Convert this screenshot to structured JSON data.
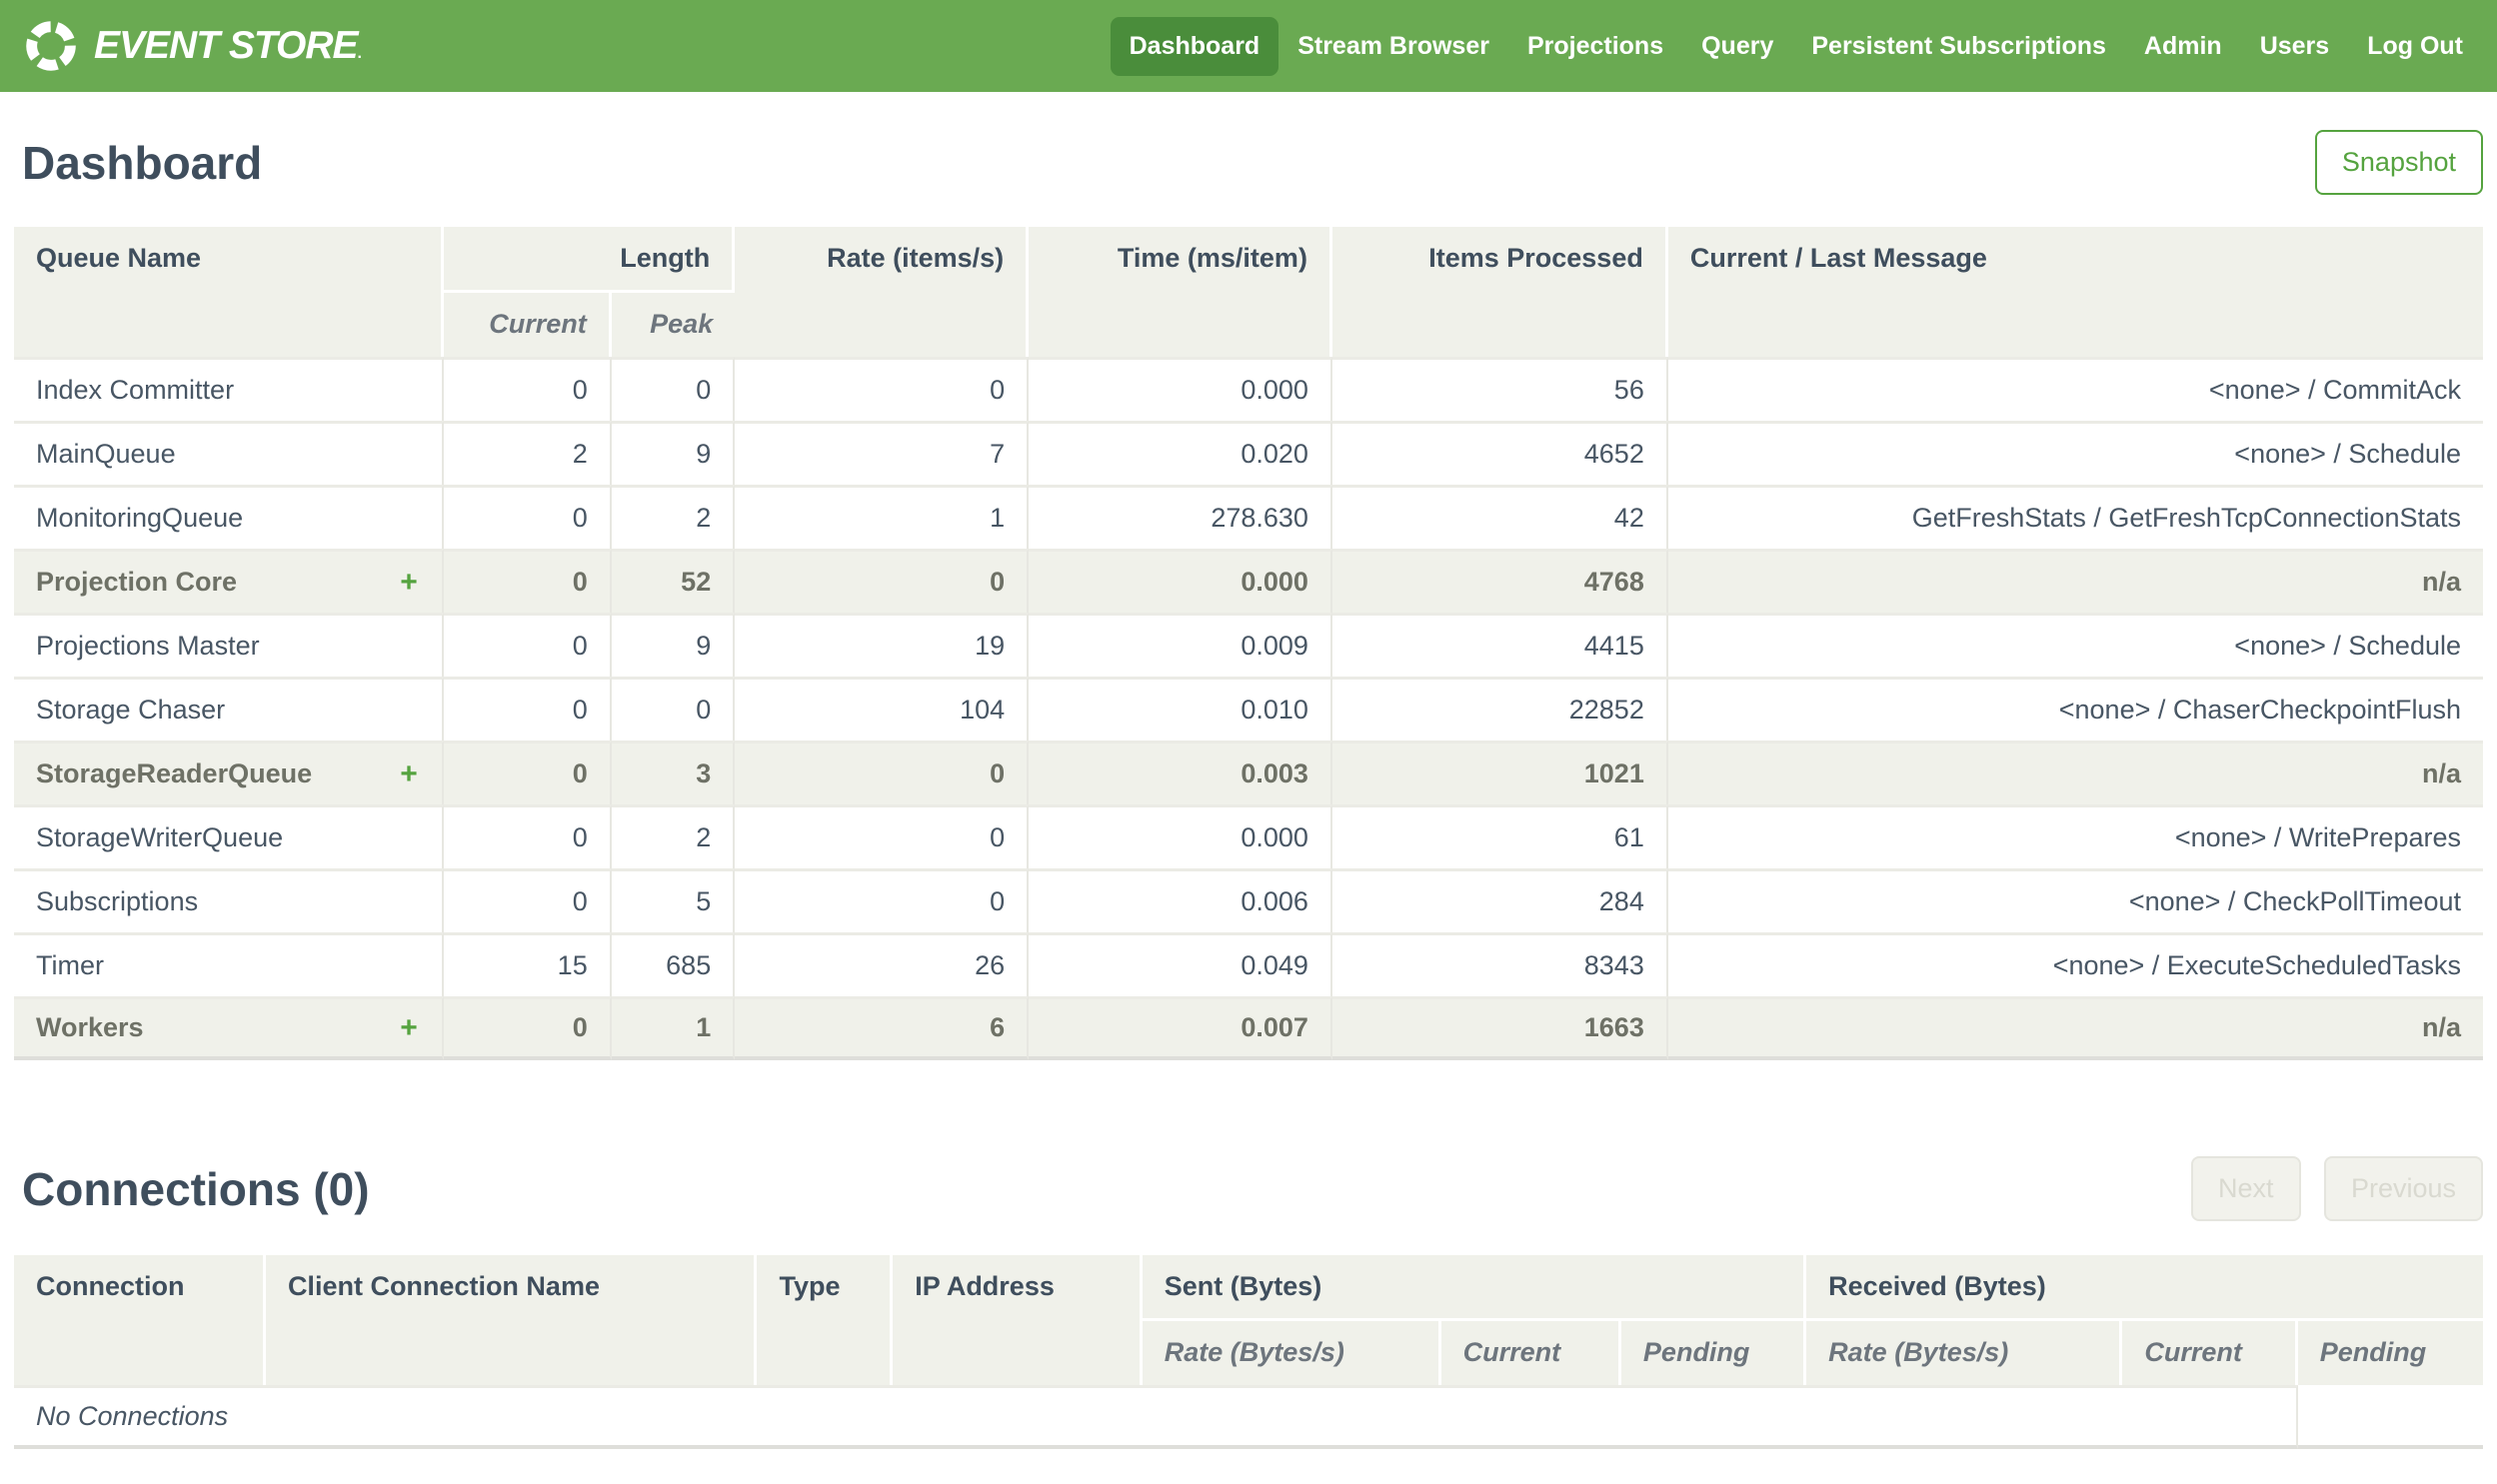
{
  "colors": {
    "nav_green": "#6aaa52",
    "nav_green_active": "#4a8d3b",
    "accent_green": "#55a33f",
    "heading_slate": "#3f4e5d",
    "header_bg": "#f0f1ea"
  },
  "nav": {
    "brand": "EVENT STORE",
    "brand_suffix": ".",
    "items": [
      {
        "label": "Dashboard",
        "active": true
      },
      {
        "label": "Stream Browser",
        "active": false
      },
      {
        "label": "Projections",
        "active": false
      },
      {
        "label": "Query",
        "active": false
      },
      {
        "label": "Persistent Subscriptions",
        "active": false
      },
      {
        "label": "Admin",
        "active": false
      },
      {
        "label": "Users",
        "active": false
      },
      {
        "label": "Log Out",
        "active": false
      }
    ]
  },
  "page": {
    "title": "Dashboard",
    "snapshot_label": "Snapshot"
  },
  "queues": {
    "expand_icon": "+",
    "headers": {
      "queue_name": "Queue Name",
      "length": "Length",
      "current": "Current",
      "peak": "Peak",
      "rate": "Rate (items/s)",
      "time": "Time (ms/item)",
      "items_processed": "Items Processed",
      "message": "Current / Last Message"
    },
    "rows": [
      {
        "name": "Index Committer",
        "group": false,
        "expandable": false,
        "current": "0",
        "peak": "0",
        "rate": "0",
        "time": "0.000",
        "items": "56",
        "message": "<none> / CommitAck"
      },
      {
        "name": "MainQueue",
        "group": false,
        "expandable": false,
        "current": "2",
        "peak": "9",
        "rate": "7",
        "time": "0.020",
        "items": "4652",
        "message": "<none> / Schedule"
      },
      {
        "name": "MonitoringQueue",
        "group": false,
        "expandable": false,
        "current": "0",
        "peak": "2",
        "rate": "1",
        "time": "278.630",
        "items": "42",
        "message": "GetFreshStats / GetFreshTcpConnectionStats"
      },
      {
        "name": "Projection Core",
        "group": true,
        "expandable": true,
        "current": "0",
        "peak": "52",
        "rate": "0",
        "time": "0.000",
        "items": "4768",
        "message": "n/a"
      },
      {
        "name": "Projections Master",
        "group": false,
        "expandable": false,
        "current": "0",
        "peak": "9",
        "rate": "19",
        "time": "0.009",
        "items": "4415",
        "message": "<none> / Schedule"
      },
      {
        "name": "Storage Chaser",
        "group": false,
        "expandable": false,
        "current": "0",
        "peak": "0",
        "rate": "104",
        "time": "0.010",
        "items": "22852",
        "message": "<none> / ChaserCheckpointFlush"
      },
      {
        "name": "StorageReaderQueue",
        "group": true,
        "expandable": true,
        "current": "0",
        "peak": "3",
        "rate": "0",
        "time": "0.003",
        "items": "1021",
        "message": "n/a"
      },
      {
        "name": "StorageWriterQueue",
        "group": false,
        "expandable": false,
        "current": "0",
        "peak": "2",
        "rate": "0",
        "time": "0.000",
        "items": "61",
        "message": "<none> / WritePrepares"
      },
      {
        "name": "Subscriptions",
        "group": false,
        "expandable": false,
        "current": "0",
        "peak": "5",
        "rate": "0",
        "time": "0.006",
        "items": "284",
        "message": "<none> / CheckPollTimeout"
      },
      {
        "name": "Timer",
        "group": false,
        "expandable": false,
        "current": "15",
        "peak": "685",
        "rate": "26",
        "time": "0.049",
        "items": "8343",
        "message": "<none> / ExecuteScheduledTasks"
      },
      {
        "name": "Workers",
        "group": true,
        "expandable": true,
        "current": "0",
        "peak": "1",
        "rate": "6",
        "time": "0.007",
        "items": "1663",
        "message": "n/a"
      }
    ]
  },
  "connections": {
    "title": "Connections (0)",
    "next_label": "Next",
    "previous_label": "Previous",
    "headers": {
      "connection": "Connection",
      "client_name": "Client Connection Name",
      "type": "Type",
      "ip": "IP Address",
      "sent": "Sent (Bytes)",
      "received": "Received (Bytes)",
      "rate": "Rate (Bytes/s)",
      "current": "Current",
      "pending": "Pending"
    },
    "empty_message": "No Connections"
  }
}
